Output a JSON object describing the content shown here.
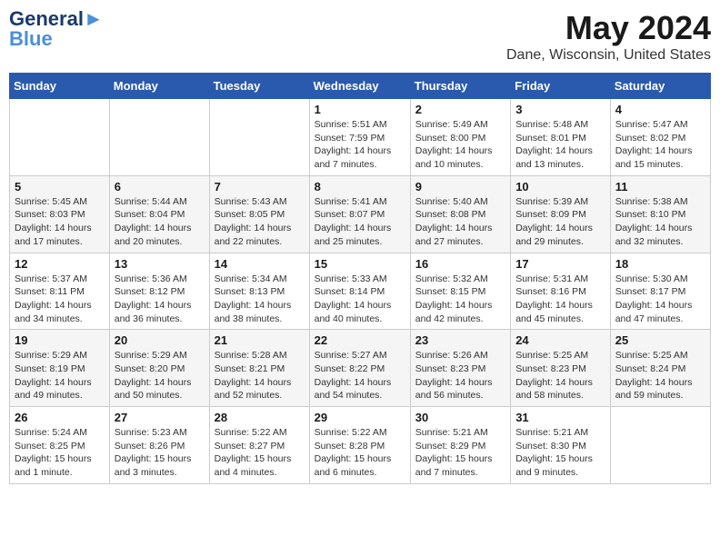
{
  "header": {
    "logo_line1": "General",
    "logo_line2": "Blue",
    "month_title": "May 2024",
    "location": "Dane, Wisconsin, United States"
  },
  "weekdays": [
    "Sunday",
    "Monday",
    "Tuesday",
    "Wednesday",
    "Thursday",
    "Friday",
    "Saturday"
  ],
  "weeks": [
    [
      {
        "day": "",
        "info": ""
      },
      {
        "day": "",
        "info": ""
      },
      {
        "day": "",
        "info": ""
      },
      {
        "day": "1",
        "info": "Sunrise: 5:51 AM\nSunset: 7:59 PM\nDaylight: 14 hours\nand 7 minutes."
      },
      {
        "day": "2",
        "info": "Sunrise: 5:49 AM\nSunset: 8:00 PM\nDaylight: 14 hours\nand 10 minutes."
      },
      {
        "day": "3",
        "info": "Sunrise: 5:48 AM\nSunset: 8:01 PM\nDaylight: 14 hours\nand 13 minutes."
      },
      {
        "day": "4",
        "info": "Sunrise: 5:47 AM\nSunset: 8:02 PM\nDaylight: 14 hours\nand 15 minutes."
      }
    ],
    [
      {
        "day": "5",
        "info": "Sunrise: 5:45 AM\nSunset: 8:03 PM\nDaylight: 14 hours\nand 17 minutes."
      },
      {
        "day": "6",
        "info": "Sunrise: 5:44 AM\nSunset: 8:04 PM\nDaylight: 14 hours\nand 20 minutes."
      },
      {
        "day": "7",
        "info": "Sunrise: 5:43 AM\nSunset: 8:05 PM\nDaylight: 14 hours\nand 22 minutes."
      },
      {
        "day": "8",
        "info": "Sunrise: 5:41 AM\nSunset: 8:07 PM\nDaylight: 14 hours\nand 25 minutes."
      },
      {
        "day": "9",
        "info": "Sunrise: 5:40 AM\nSunset: 8:08 PM\nDaylight: 14 hours\nand 27 minutes."
      },
      {
        "day": "10",
        "info": "Sunrise: 5:39 AM\nSunset: 8:09 PM\nDaylight: 14 hours\nand 29 minutes."
      },
      {
        "day": "11",
        "info": "Sunrise: 5:38 AM\nSunset: 8:10 PM\nDaylight: 14 hours\nand 32 minutes."
      }
    ],
    [
      {
        "day": "12",
        "info": "Sunrise: 5:37 AM\nSunset: 8:11 PM\nDaylight: 14 hours\nand 34 minutes."
      },
      {
        "day": "13",
        "info": "Sunrise: 5:36 AM\nSunset: 8:12 PM\nDaylight: 14 hours\nand 36 minutes."
      },
      {
        "day": "14",
        "info": "Sunrise: 5:34 AM\nSunset: 8:13 PM\nDaylight: 14 hours\nand 38 minutes."
      },
      {
        "day": "15",
        "info": "Sunrise: 5:33 AM\nSunset: 8:14 PM\nDaylight: 14 hours\nand 40 minutes."
      },
      {
        "day": "16",
        "info": "Sunrise: 5:32 AM\nSunset: 8:15 PM\nDaylight: 14 hours\nand 42 minutes."
      },
      {
        "day": "17",
        "info": "Sunrise: 5:31 AM\nSunset: 8:16 PM\nDaylight: 14 hours\nand 45 minutes."
      },
      {
        "day": "18",
        "info": "Sunrise: 5:30 AM\nSunset: 8:17 PM\nDaylight: 14 hours\nand 47 minutes."
      }
    ],
    [
      {
        "day": "19",
        "info": "Sunrise: 5:29 AM\nSunset: 8:19 PM\nDaylight: 14 hours\nand 49 minutes."
      },
      {
        "day": "20",
        "info": "Sunrise: 5:29 AM\nSunset: 8:20 PM\nDaylight: 14 hours\nand 50 minutes."
      },
      {
        "day": "21",
        "info": "Sunrise: 5:28 AM\nSunset: 8:21 PM\nDaylight: 14 hours\nand 52 minutes."
      },
      {
        "day": "22",
        "info": "Sunrise: 5:27 AM\nSunset: 8:22 PM\nDaylight: 14 hours\nand 54 minutes."
      },
      {
        "day": "23",
        "info": "Sunrise: 5:26 AM\nSunset: 8:23 PM\nDaylight: 14 hours\nand 56 minutes."
      },
      {
        "day": "24",
        "info": "Sunrise: 5:25 AM\nSunset: 8:23 PM\nDaylight: 14 hours\nand 58 minutes."
      },
      {
        "day": "25",
        "info": "Sunrise: 5:25 AM\nSunset: 8:24 PM\nDaylight: 14 hours\nand 59 minutes."
      }
    ],
    [
      {
        "day": "26",
        "info": "Sunrise: 5:24 AM\nSunset: 8:25 PM\nDaylight: 15 hours\nand 1 minute."
      },
      {
        "day": "27",
        "info": "Sunrise: 5:23 AM\nSunset: 8:26 PM\nDaylight: 15 hours\nand 3 minutes."
      },
      {
        "day": "28",
        "info": "Sunrise: 5:22 AM\nSunset: 8:27 PM\nDaylight: 15 hours\nand 4 minutes."
      },
      {
        "day": "29",
        "info": "Sunrise: 5:22 AM\nSunset: 8:28 PM\nDaylight: 15 hours\nand 6 minutes."
      },
      {
        "day": "30",
        "info": "Sunrise: 5:21 AM\nSunset: 8:29 PM\nDaylight: 15 hours\nand 7 minutes."
      },
      {
        "day": "31",
        "info": "Sunrise: 5:21 AM\nSunset: 8:30 PM\nDaylight: 15 hours\nand 9 minutes."
      },
      {
        "day": "",
        "info": ""
      }
    ]
  ]
}
